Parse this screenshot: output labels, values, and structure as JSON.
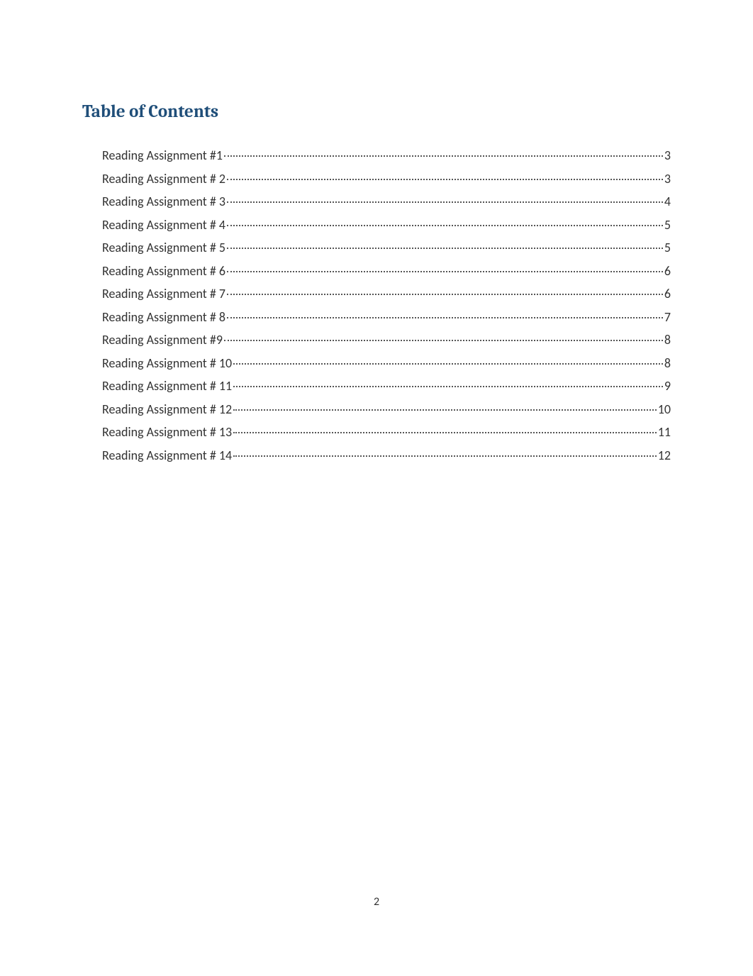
{
  "heading": "Table of Contents",
  "toc": [
    {
      "title": "Reading Assignment #1",
      "page": "3"
    },
    {
      "title": "Reading Assignment # 2",
      "page": "3"
    },
    {
      "title": "Reading Assignment # 3",
      "page": "4"
    },
    {
      "title": "Reading Assignment  # 4",
      "page": "5"
    },
    {
      "title": "Reading Assignment # 5",
      "page": "5"
    },
    {
      "title": "Reading Assignment # 6",
      "page": "6"
    },
    {
      "title": "Reading Assignment # 7",
      "page": "6"
    },
    {
      "title": "Reading Assignment # 8",
      "page": "7"
    },
    {
      "title": "Reading Assignment #9",
      "page": "8"
    },
    {
      "title": "Reading Assignment # 10",
      "page": "8"
    },
    {
      "title": "Reading Assignment # 11",
      "page": "9"
    },
    {
      "title": "Reading Assignment # 12",
      "page": "10"
    },
    {
      "title": "Reading Assignment # 13",
      "page": "11"
    },
    {
      "title": "Reading Assignment # 14",
      "page": "12"
    }
  ],
  "page_number": "2"
}
